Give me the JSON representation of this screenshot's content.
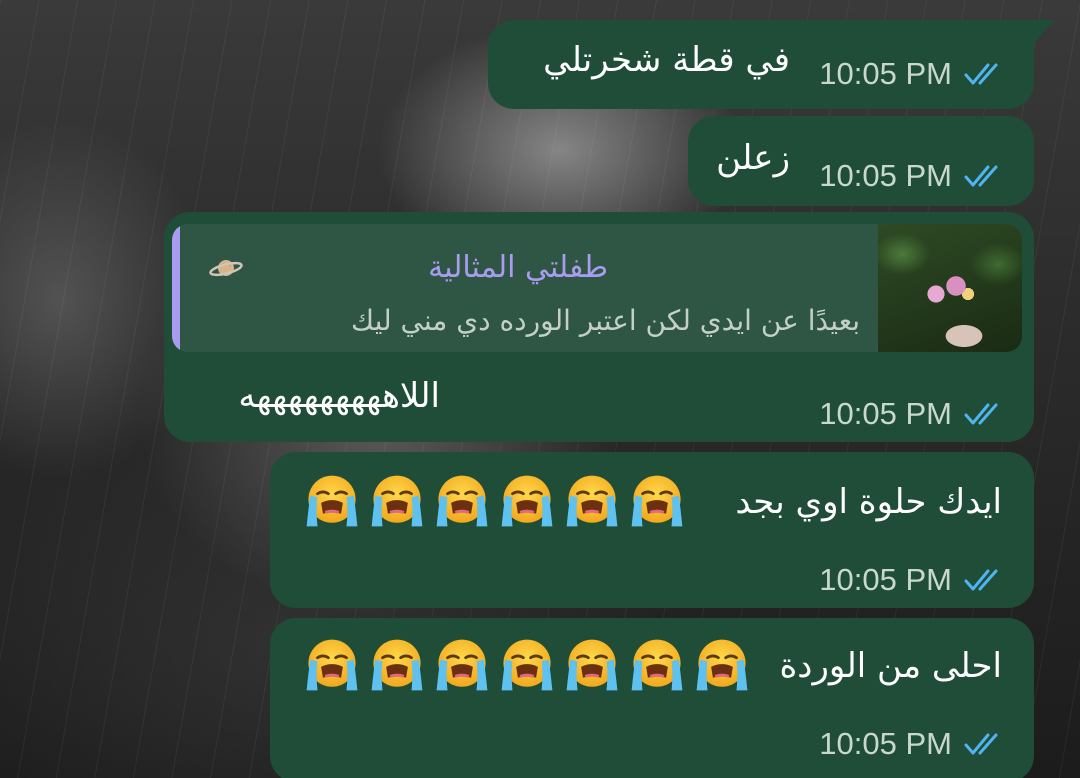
{
  "messages": [
    {
      "text": "في  قطة شخرتلي",
      "time": "10:05 PM"
    },
    {
      "text": "زعلن",
      "time": "10:05 PM"
    },
    {
      "reply": {
        "sender": "طفلتي المثالية",
        "snippet": "بعيدًا عن ايدي لكن اعتبر الورده دي مني ليك",
        "sender_icon": "planet-icon",
        "snippet_icon": "image-icon"
      },
      "text": "اللاهههههههههه",
      "time": "10:05 PM"
    },
    {
      "text": "ايدك حلوة اوي بجد",
      "emoji": "😭😭😭😭😭😭",
      "emoji_count": 6,
      "time": "10:05 PM"
    },
    {
      "text": "احلى من الوردة",
      "emoji": "😭😭😭😭😭😭😭",
      "emoji_count": 7,
      "time": "10:05 PM"
    }
  ],
  "colors": {
    "bubble": "#1f4d38",
    "reply_accent": "#a99cf0",
    "read_ticks": "#4fb4f0",
    "time": "#c9d8cf"
  },
  "status_icon": "double-check-icon"
}
